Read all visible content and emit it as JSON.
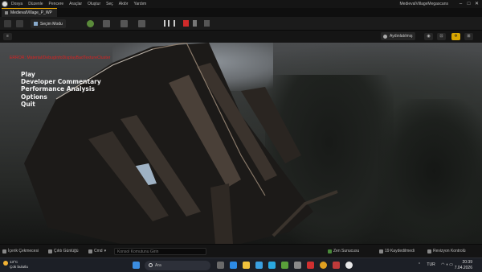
{
  "menubar": {
    "items": [
      "Dosya",
      "Düzenle",
      "Pencere",
      "Araçlar",
      "Oluştur",
      "Seç",
      "Aktör",
      "Yardım"
    ],
    "project_name": "MedievalVillageMegascans",
    "minimize": "–",
    "maximize": "□",
    "close": "✕"
  },
  "tab": {
    "label": "MedievalVillage_P_WP"
  },
  "toolbar": {
    "mode_label": "Seçim Modu"
  },
  "viewport_header": {
    "lighting_label": "Aydınlatılmış"
  },
  "hud": {
    "warning_text": "ERROR: Material/DebugInfoDisplayBadTextureCluster",
    "menu": [
      "Play",
      "Developer Commentary",
      "Performance Analysis",
      "Options",
      "Quit"
    ]
  },
  "statusbar": {
    "content_drawer": "İçerik Çekmecesi",
    "output_log": "Çıktı Günlüğü",
    "cmd_label": "Cmd",
    "cmd_placeholder": "Konsol Komutunu Girin",
    "derived_data": "Zen Sunucusu",
    "unsaved": "19 Kaydedilmedi",
    "source_control": "Revizyon Kontrolü"
  },
  "taskbar": {
    "temperature": "13°C",
    "weather": "Çok bulutlu",
    "search_placeholder": "Ara",
    "language": "TUR",
    "time": "20:39",
    "date": "7.04.2026"
  },
  "colors": {
    "accent_tab": "#e0a000",
    "hud_warning": "#e02020",
    "taskbar_bg": "#1c1f26"
  }
}
